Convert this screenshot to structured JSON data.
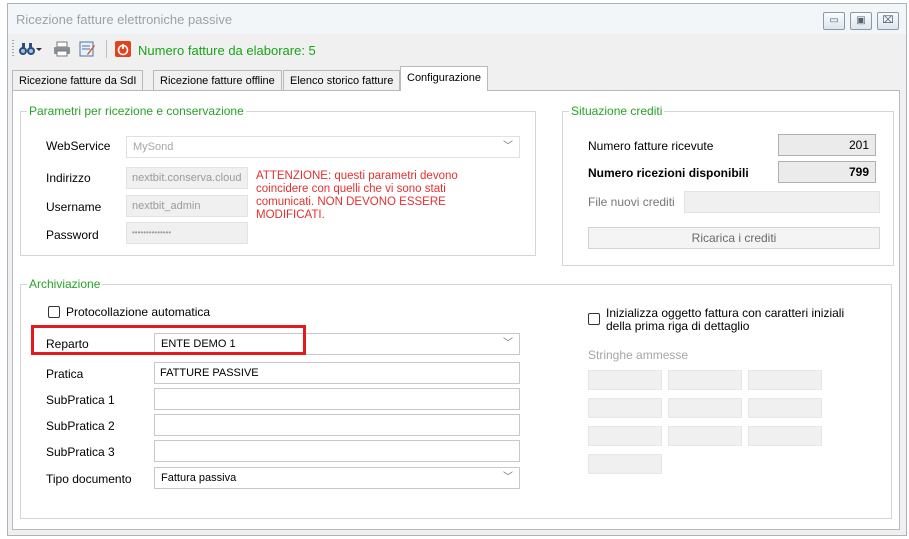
{
  "window": {
    "title": "Ricezione fatture elettroniche passive",
    "btn_min": "▭",
    "btn_max": "▣",
    "btn_close": "⌧"
  },
  "toolbar": {
    "status": "Numero fatture da elaborare: 5"
  },
  "tabs": [
    {
      "label": "Ricezione fatture da SdI"
    },
    {
      "label": "Ricezione fatture offline"
    },
    {
      "label": "Elenco storico fatture"
    },
    {
      "label": "Configurazione"
    }
  ],
  "params": {
    "legend": "Parametri per ricezione e conservazione",
    "webservice_label": "WebService",
    "webservice_value": "MySond",
    "indirizzo_label": "Indirizzo",
    "indirizzo_value": "nextbit.conserva.cloud",
    "username_label": "Username",
    "username_value": "nextbit_admin",
    "password_label": "Password",
    "password_value": "••••••••••••••",
    "warning": "ATTENZIONE: questi parametri devono coincidere con quelli che vi sono stati comunicati. NON DEVONO ESSERE MODIFICATI."
  },
  "crediti": {
    "legend": "Situazione crediti",
    "ricevute_label": "Numero fatture ricevute",
    "ricevute_value": "201",
    "disponibili_label": "Numero ricezioni disponibili",
    "disponibili_value": "799",
    "file_label": "File nuovi crediti",
    "file_value": "",
    "ricarica_label": "Ricarica i crediti"
  },
  "archiviazione": {
    "legend": "Archiviazione",
    "protocollazione_label": "Protocollazione automatica",
    "reparto_label": "Reparto",
    "reparto_value": "ENTE DEMO 1",
    "pratica_label": "Pratica",
    "pratica_value": "FATTURE PASSIVE",
    "subpratica1_label": "SubPratica 1",
    "subpratica1_value": "",
    "subpratica2_label": "SubPratica 2",
    "subpratica2_value": "",
    "subpratica3_label": "SubPratica 3",
    "subpratica3_value": "",
    "tipo_label": "Tipo documento",
    "tipo_value": "Fattura passiva",
    "inizializza_label": "Inizializza oggetto fattura con caratteri iniziali della prima riga di dettaglio",
    "stringhe_label": "Stringhe ammesse"
  }
}
